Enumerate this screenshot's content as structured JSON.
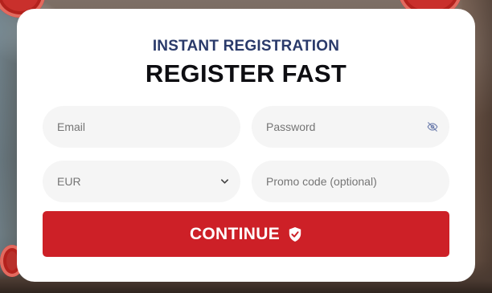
{
  "form": {
    "subtitle": "INSTANT REGISTRATION",
    "title": "REGISTER FAST",
    "email_placeholder": "Email",
    "password_placeholder": "Password",
    "currency_value": "EUR",
    "promo_placeholder": "Promo code (optional)",
    "continue_label": "CONTINUE"
  },
  "colors": {
    "accent": "#cd2027",
    "subtitle": "#2a3a6a",
    "field_bg": "#f5f5f5"
  },
  "icons": {
    "password_toggle": "eye-off-icon",
    "currency_dropdown": "chevron-down-icon",
    "continue_badge": "shield-check-icon"
  }
}
